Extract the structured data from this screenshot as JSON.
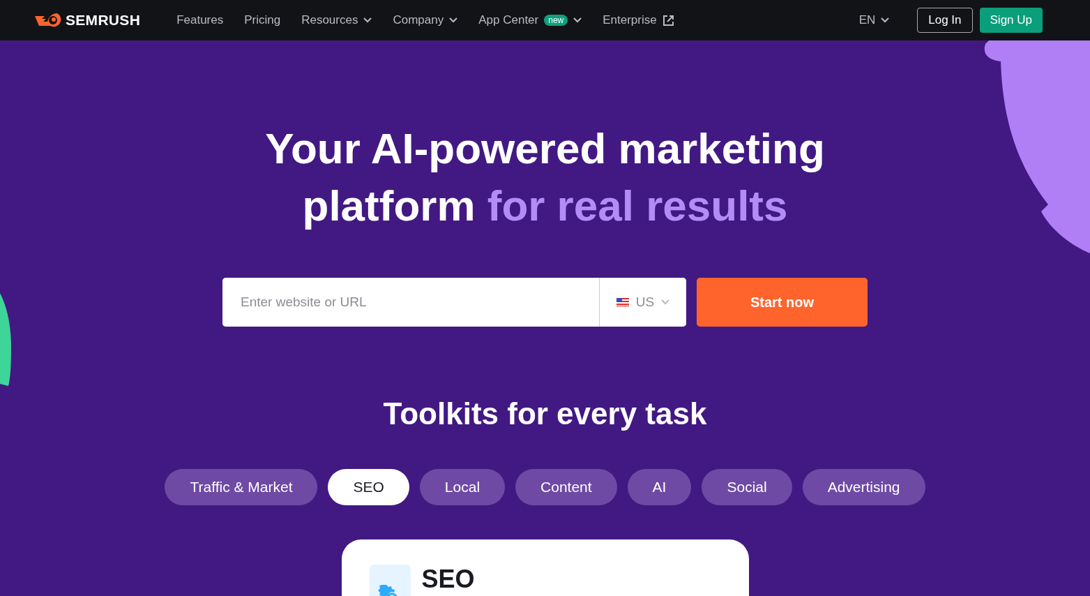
{
  "header": {
    "logo": "SEMRUSH",
    "nav": [
      {
        "label": "Features",
        "dropdown": false,
        "external": false
      },
      {
        "label": "Pricing",
        "dropdown": false,
        "external": false
      },
      {
        "label": "Resources",
        "dropdown": true,
        "external": false
      },
      {
        "label": "Company",
        "dropdown": true,
        "external": false
      },
      {
        "label": "App Center",
        "dropdown": true,
        "badge": "new",
        "external": false
      },
      {
        "label": "Enterprise",
        "dropdown": false,
        "external": true
      }
    ],
    "language": "EN",
    "login": "Log In",
    "signup": "Sign Up"
  },
  "hero": {
    "title": "Your AI-powered marketing platform",
    "title_highlight": "for real results",
    "search": {
      "placeholder": "Enter website or URL",
      "country": "US",
      "button": "Start now"
    }
  },
  "toolkits": {
    "heading": "Toolkits for every task",
    "tabs": [
      {
        "label": "Traffic & Market",
        "selected": false
      },
      {
        "label": "SEO",
        "selected": true
      },
      {
        "label": "Local",
        "selected": false
      },
      {
        "label": "Content",
        "selected": false
      },
      {
        "label": "AI",
        "selected": false
      },
      {
        "label": "Social",
        "selected": false
      },
      {
        "label": "Advertising",
        "selected": false
      }
    ],
    "card": {
      "title": "SEO"
    }
  }
}
